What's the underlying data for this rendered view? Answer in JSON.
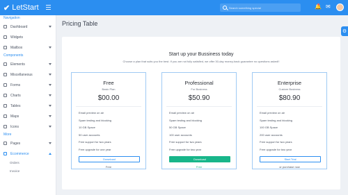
{
  "app": {
    "brand": "LetStart",
    "search_placeholder": "Search something special"
  },
  "sidebar": {
    "navigation_title": "Navigation",
    "nav_items": [
      {
        "label": "Dashboard",
        "icon": "home-icon",
        "has_chevron": true
      },
      {
        "label": "Widgets",
        "icon": "widgets-icon",
        "has_chevron": false
      },
      {
        "label": "Mailbox",
        "icon": "mail-icon",
        "has_chevron": true
      }
    ],
    "components_title": "Components",
    "component_items": [
      {
        "label": "Elements",
        "icon": "elements-icon"
      },
      {
        "label": "Miscellaneous",
        "icon": "misc-icon"
      },
      {
        "label": "Forms",
        "icon": "forms-icon"
      },
      {
        "label": "Charts",
        "icon": "charts-icon"
      },
      {
        "label": "Tables",
        "icon": "tables-icon"
      },
      {
        "label": "Maps",
        "icon": "maps-icon"
      },
      {
        "label": "Icons",
        "icon": "icons-icon"
      }
    ],
    "more_title": "More",
    "more_items": [
      {
        "label": "Pages",
        "icon": "pages-icon"
      },
      {
        "label": "Ecommerce",
        "icon": "cart-icon",
        "active": true
      }
    ],
    "sub_items": [
      "Orders",
      "Invoice"
    ]
  },
  "main": {
    "page_title": "Pricing Table",
    "heading": "Start up your Bussiness today",
    "subheading": "Choose a plan that suits you the best. If you are not fully satisfied, we offer 30-day money-back guarantee no questions asked!!"
  },
  "plans": [
    {
      "name": "Free",
      "subtitle": "Basic Plan",
      "price": "$00.00",
      "features": [
        "Email preview on air",
        "Spam testing and blocking",
        "10 GB Space",
        "50 user accounts",
        "Free support for two years",
        "Free upgrade for one year"
      ],
      "button": "Download",
      "button_style": "outline",
      "footer": "Free",
      "footer_color": "#4a5260"
    },
    {
      "name": "Professional",
      "subtitle": "For Business",
      "price": "$50.90",
      "features": [
        "Email preview on air",
        "Spam testing and blocking",
        "50 GB Space",
        "100 user accounts",
        "Free support for two years",
        "Free upgrade for two year"
      ],
      "button": "Download",
      "button_style": "filled",
      "footer": "Free",
      "footer_color": "#18b68a"
    },
    {
      "name": "Enterprise",
      "subtitle": "Custom Business",
      "price": "$80.90",
      "features": [
        "Email preview on air",
        "Spam testing and blocking",
        "100 GB Space",
        "200 user accounts",
        "Free support for two years",
        "Free upgrade for two year"
      ],
      "button": "Start Trial",
      "button_style": "outline",
      "footer": "or purchase now",
      "footer_color": "#4a5260"
    }
  ],
  "colors": {
    "primary": "#2b8ef0",
    "success": "#18b68a"
  }
}
